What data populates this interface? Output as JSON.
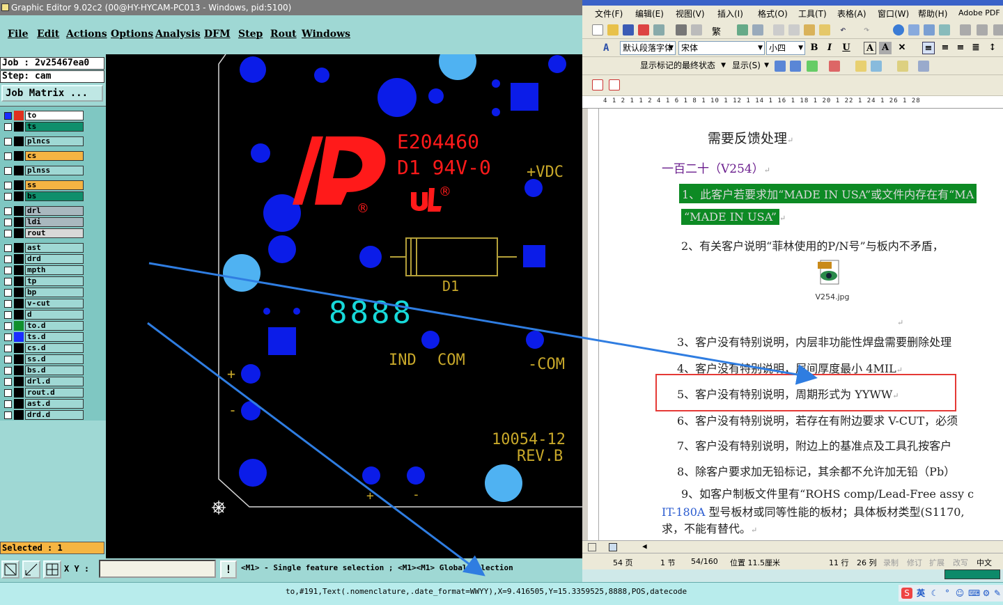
{
  "graphic_editor": {
    "title": "Graphic Editor 9.02c2 (00@HY-HYCAM-PC013 - Windows, pid:5100)",
    "menu": [
      "File",
      "Edit",
      "Actions",
      "Options",
      "Analysis",
      "DFM",
      "Step",
      "Rout",
      "Windows"
    ],
    "job_label": "Job  : 2v25467ea0",
    "step_label": "Step: cam",
    "job_matrix_button": "Job Matrix ...",
    "layers": [
      {
        "name": "to",
        "color": "#ffffff"
      },
      {
        "name": "ts",
        "color": "#0f8f6c"
      },
      {
        "name": "plncs",
        "color": "#9fd8d4"
      },
      {
        "name": "cs",
        "color": "#f5b443"
      },
      {
        "name": "plnss",
        "color": "#9fd8d4"
      },
      {
        "name": "ss",
        "color": "#f5b443"
      },
      {
        "name": "bs",
        "color": "#0f8f6c"
      },
      {
        "name": "drl",
        "color": "#a9b8bf"
      },
      {
        "name": "ldi",
        "color": "#a9b8bf"
      },
      {
        "name": "rout",
        "color": "#d8d8d8"
      },
      {
        "name": "ast",
        "color": "#9fd8d4"
      },
      {
        "name": "drd",
        "color": "#9fd8d4"
      },
      {
        "name": "mpth",
        "color": "#9fd8d4"
      },
      {
        "name": "tp",
        "color": "#9fd8d4"
      },
      {
        "name": "bp",
        "color": "#9fd8d4"
      },
      {
        "name": "v-cut",
        "color": "#9fd8d4"
      },
      {
        "name": "d",
        "color": "#9fd8d4"
      },
      {
        "name": "to.d",
        "color": "#9fd8d4"
      },
      {
        "name": "ts.d",
        "color": "#9fd8d4"
      },
      {
        "name": "cs.d",
        "color": "#9fd8d4"
      },
      {
        "name": "ss.d",
        "color": "#9fd8d4"
      },
      {
        "name": "bs.d",
        "color": "#9fd8d4"
      },
      {
        "name": "drl.d",
        "color": "#9fd8d4"
      },
      {
        "name": "rout.d",
        "color": "#9fd8d4"
      },
      {
        "name": "ast.d",
        "color": "#9fd8d4"
      },
      {
        "name": "drd.d",
        "color": "#9fd8d4"
      }
    ],
    "selected_label": "Selected : 1",
    "xy_label": "X Y :",
    "xy_value": "",
    "hint": "<M1> - Single feature selection ; <M1><M1> Global selection",
    "canvas": {
      "ul_code": "E204460",
      "rating": "D1  94V-0",
      "vdc": "+VDC",
      "diode_label": "D1",
      "seg_display": "8888",
      "ind": "IND",
      "com": "COM",
      "neg_com": "-COM",
      "plus": "+",
      "minus": "-",
      "part_no": "10054-12",
      "rev": "REV.B",
      "r_mark": "®"
    }
  },
  "status_line": "to,#191,Text(.nomenclature,.date_format=WWYY),X=9.416505,Y=15.3359525,8888,POS,datecode",
  "tray": {
    "lang": "英"
  },
  "word": {
    "menu": [
      "文件(F)",
      "编辑(E)",
      "视图(V)",
      "插入(I)",
      "格式(O)",
      "工具(T)",
      "表格(A)",
      "窗口(W)",
      "帮助(H)",
      "Adobe PDF"
    ],
    "style_combo": "默认段落字体",
    "font_combo": "宋体",
    "size_combo": "小四",
    "review_combo": "显示标记的最终状态",
    "show_button": "显示(S)",
    "ruler_text": "4 1 2 1 1 2 4 1 6 1 8 1 10 1 12 1 14 1 16 1 18 1 20 1 22 1 24 1 26 1 28",
    "doc": {
      "heading": "需要反馈处理",
      "section": "一百二十（V254）",
      "item1_a": "1、此客户若要求加“MADE IN USA”或文件内存在有“MA",
      "item1_b": "“MADE IN USA”",
      "item2": "2、有关客户说明“菲林使用的P/N号”与板内不矛盾，",
      "attachment": "V254.jpg",
      "item3": "3、客户没有特别说明，内层非功能性焊盘需要删除处理",
      "item4": "4、客户没有特别说明，层间厚度最小 4MIL",
      "item5": "5、客户没有特别说明，周期形式为 YYWW",
      "item6": "6、客户没有特别说明，若存在有附边要求 V-CUT，必须",
      "item7": "7、客户没有特别说明，附边上的基准点及工具孔按客户",
      "item8": "8、除客户要求加无铅标记，其余都不允许加无铅（Pb）",
      "item9_a": "9、如客户制板文件里有“ROHS comp/Lead-Free assy c",
      "item9_b1": "IT-180A",
      "item9_b2": " 型号板材或同等性能的板材；具体板材类型(S1170,",
      "item9_c": "求，不能有替代。"
    },
    "status": {
      "page": "54 页",
      "section": "1 节",
      "pages": "54/160",
      "position": "位置 11.5厘米",
      "line": "11 行",
      "col": "26 列",
      "rec": "录制",
      "trk": "修订",
      "ext": "扩展",
      "ovr": "改写",
      "lang": "中文"
    }
  }
}
